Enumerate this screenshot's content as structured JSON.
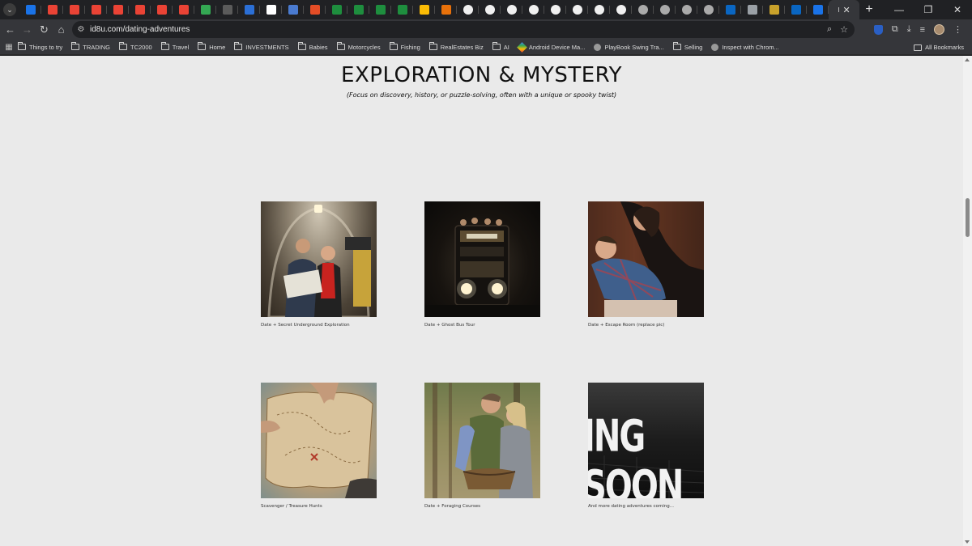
{
  "browser": {
    "tabs_count_visible": 38,
    "active_tab_label": "I",
    "url": "id8u.com/dating-adventures",
    "bookmarks": [
      {
        "label": "Things to try",
        "kind": "folder"
      },
      {
        "label": "TRADING",
        "kind": "folder"
      },
      {
        "label": "TC2000",
        "kind": "folder"
      },
      {
        "label": "Travel",
        "kind": "folder"
      },
      {
        "label": "Home",
        "kind": "folder"
      },
      {
        "label": "INVESTMENTS",
        "kind": "folder"
      },
      {
        "label": "Babies",
        "kind": "folder"
      },
      {
        "label": "Motorcycles",
        "kind": "folder"
      },
      {
        "label": "Fishing",
        "kind": "folder"
      },
      {
        "label": "RealEstates Biz",
        "kind": "folder"
      },
      {
        "label": "AI",
        "kind": "folder"
      },
      {
        "label": "Android Device Ma...",
        "kind": "diamond"
      },
      {
        "label": "PlayBook Swing Tra...",
        "kind": "globe"
      },
      {
        "label": "Selling",
        "kind": "folder"
      },
      {
        "label": "Inspect with Chrom...",
        "kind": "globe"
      }
    ],
    "all_bookmarks_label": "All Bookmarks"
  },
  "page": {
    "title": "EXPLORATION & MYSTERY",
    "subtitle": "(Focus on discovery, history, or puzzle-solving, often with a unique or spooky twist)",
    "cards": [
      {
        "caption": "Date + Secret Underground Exploration",
        "image": "couple-in-tunnel-with-map"
      },
      {
        "caption": "Date + Ghost Bus Tour",
        "image": "double-decker-bus-at-night"
      },
      {
        "caption": "Date + Escape Room (replace pic)",
        "image": "couple-solving-puzzle"
      },
      {
        "caption": "Scavenger / Treasure Hunts",
        "image": "hands-holding-old-map"
      },
      {
        "caption": "Date + Foraging Courses",
        "image": "couple-foraging-in-woods"
      },
      {
        "caption": "And more dating adventures coming...",
        "image": "coming-soon-sign",
        "sign_text": "ING SOON"
      }
    ]
  }
}
